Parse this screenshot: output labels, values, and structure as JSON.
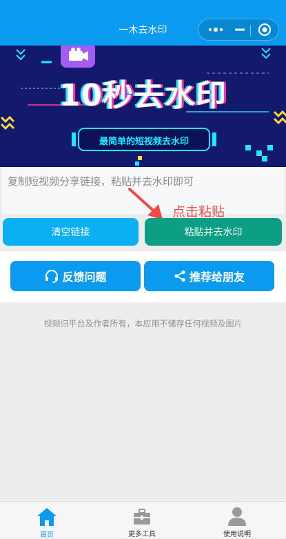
{
  "nav": {
    "title": "一木去水印"
  },
  "banner": {
    "headline": "10秒去水印",
    "tagline": "最简单的短视频去水印"
  },
  "input": {
    "placeholder": "复制短视频分享链接，粘贴并去水印即可",
    "value": ""
  },
  "actions": {
    "clear_label": "清空链接",
    "paste_label": "粘贴并去水印",
    "hint_label": "点击粘贴"
  },
  "secondary": {
    "feedback_label": "反馈问题",
    "share_label": "推荐给朋友"
  },
  "disclaimer": "视频归平台及作者所有，本应用不储存任何视频及图片",
  "tabbar": {
    "items": [
      {
        "label": "首页",
        "icon": "home-icon",
        "active": true
      },
      {
        "label": "更多工具",
        "icon": "toolbox-icon",
        "active": false
      },
      {
        "label": "使用说明",
        "icon": "user-icon",
        "active": false
      }
    ]
  },
  "colors": {
    "primary": "#0a9bf0",
    "teal": "#0d9e86",
    "inactive_tab": "#9a9a9a",
    "hint": "#f04a4a"
  }
}
